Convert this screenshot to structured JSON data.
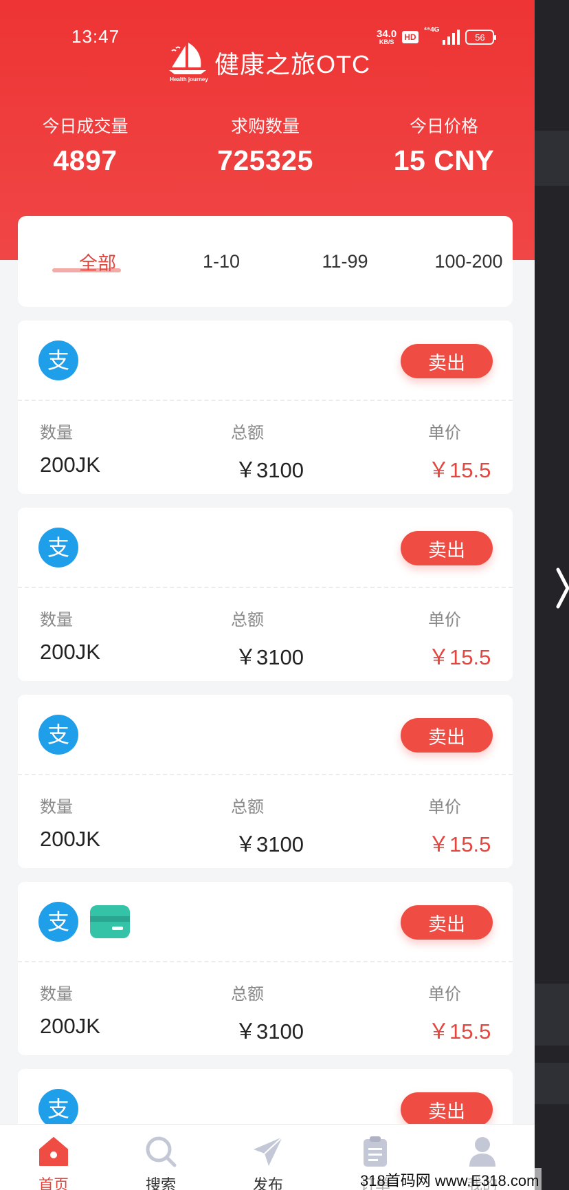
{
  "status_bar": {
    "time": "13:47",
    "net_speed": "34.0",
    "net_speed_unit": "KB/S",
    "hd": "HD",
    "net_type": "⁴⁶4G",
    "battery": "56"
  },
  "brand": {
    "title": "健康之旅OTC",
    "logo_text": "Health journey"
  },
  "stats": [
    {
      "label": "今日成交量",
      "value": "4897"
    },
    {
      "label": "求购数量",
      "value": "725325"
    },
    {
      "label": "今日价格",
      "value": "15 CNY"
    }
  ],
  "filter_tabs": [
    "全部",
    "1-10",
    "11-99",
    "100-200"
  ],
  "offer_labels": {
    "quantity": "数量",
    "total": "总额",
    "price": "单价",
    "sell": "卖出"
  },
  "offers": [
    {
      "quantity": "200JK",
      "total": "￥3100",
      "price": "￥15.5",
      "methods": [
        "alipay-icon"
      ]
    },
    {
      "quantity": "200JK",
      "total": "￥3100",
      "price": "￥15.5",
      "methods": [
        "alipay-icon"
      ]
    },
    {
      "quantity": "200JK",
      "total": "￥3100",
      "price": "￥15.5",
      "methods": [
        "alipay-icon"
      ]
    },
    {
      "quantity": "200JK",
      "total": "￥3100",
      "price": "￥15.5",
      "methods": [
        "alipay-icon",
        "bank-card-icon"
      ]
    },
    {
      "methods": [
        "alipay-icon"
      ]
    }
  ],
  "bottom_nav": [
    {
      "label": "首页",
      "icon": "home-icon",
      "active": true
    },
    {
      "label": "搜索",
      "icon": "search-icon"
    },
    {
      "label": "发布",
      "icon": "send-icon"
    },
    {
      "label": "订单",
      "icon": "clipboard-icon"
    },
    {
      "label": "我的",
      "icon": "user-icon"
    }
  ],
  "watermark": "318首码网 www.E318.com",
  "colors": {
    "brand_red": "#ee3434",
    "accent": "#e4453c",
    "alipay_blue": "#1f9eea",
    "card_green": "#35c3a8"
  }
}
